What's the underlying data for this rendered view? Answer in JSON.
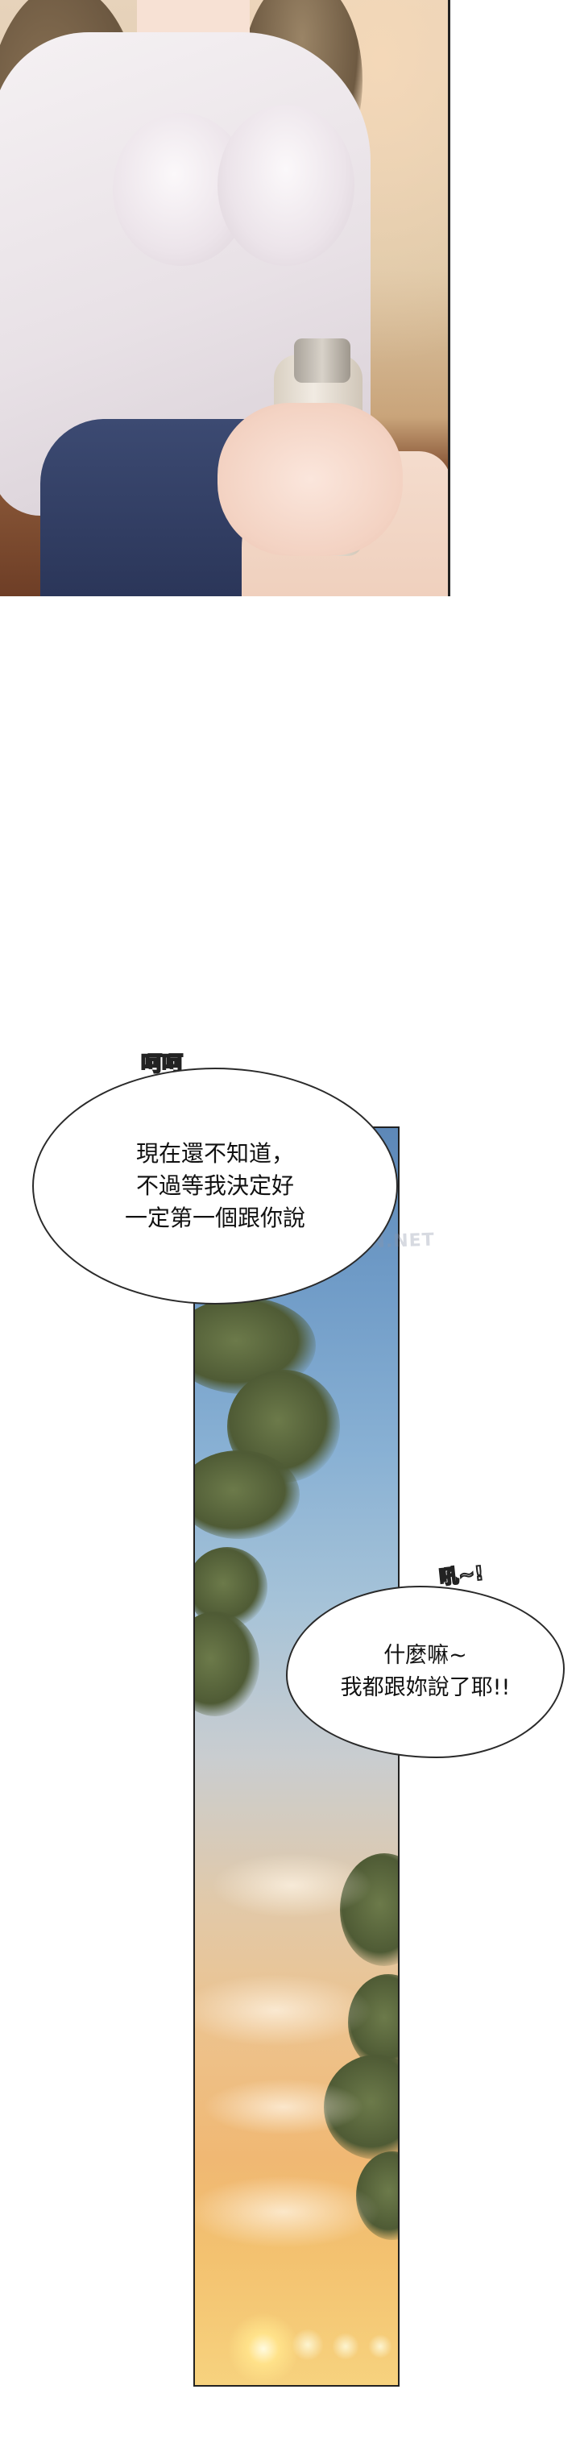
{
  "bubbles": [
    {
      "sfx": "呵呵",
      "lines": [
        "現在還不知道，",
        "不過等我決定好",
        "一定第一個跟你說"
      ]
    },
    {
      "sfx": "吼~!",
      "lines": [
        "什麼嘛~",
        "我都跟妳說了耶!!"
      ]
    }
  ],
  "watermark": "QOOTOON.NET",
  "colors": {
    "border": "#222222",
    "bubble_bg": "#ffffff",
    "text": "#111111"
  }
}
